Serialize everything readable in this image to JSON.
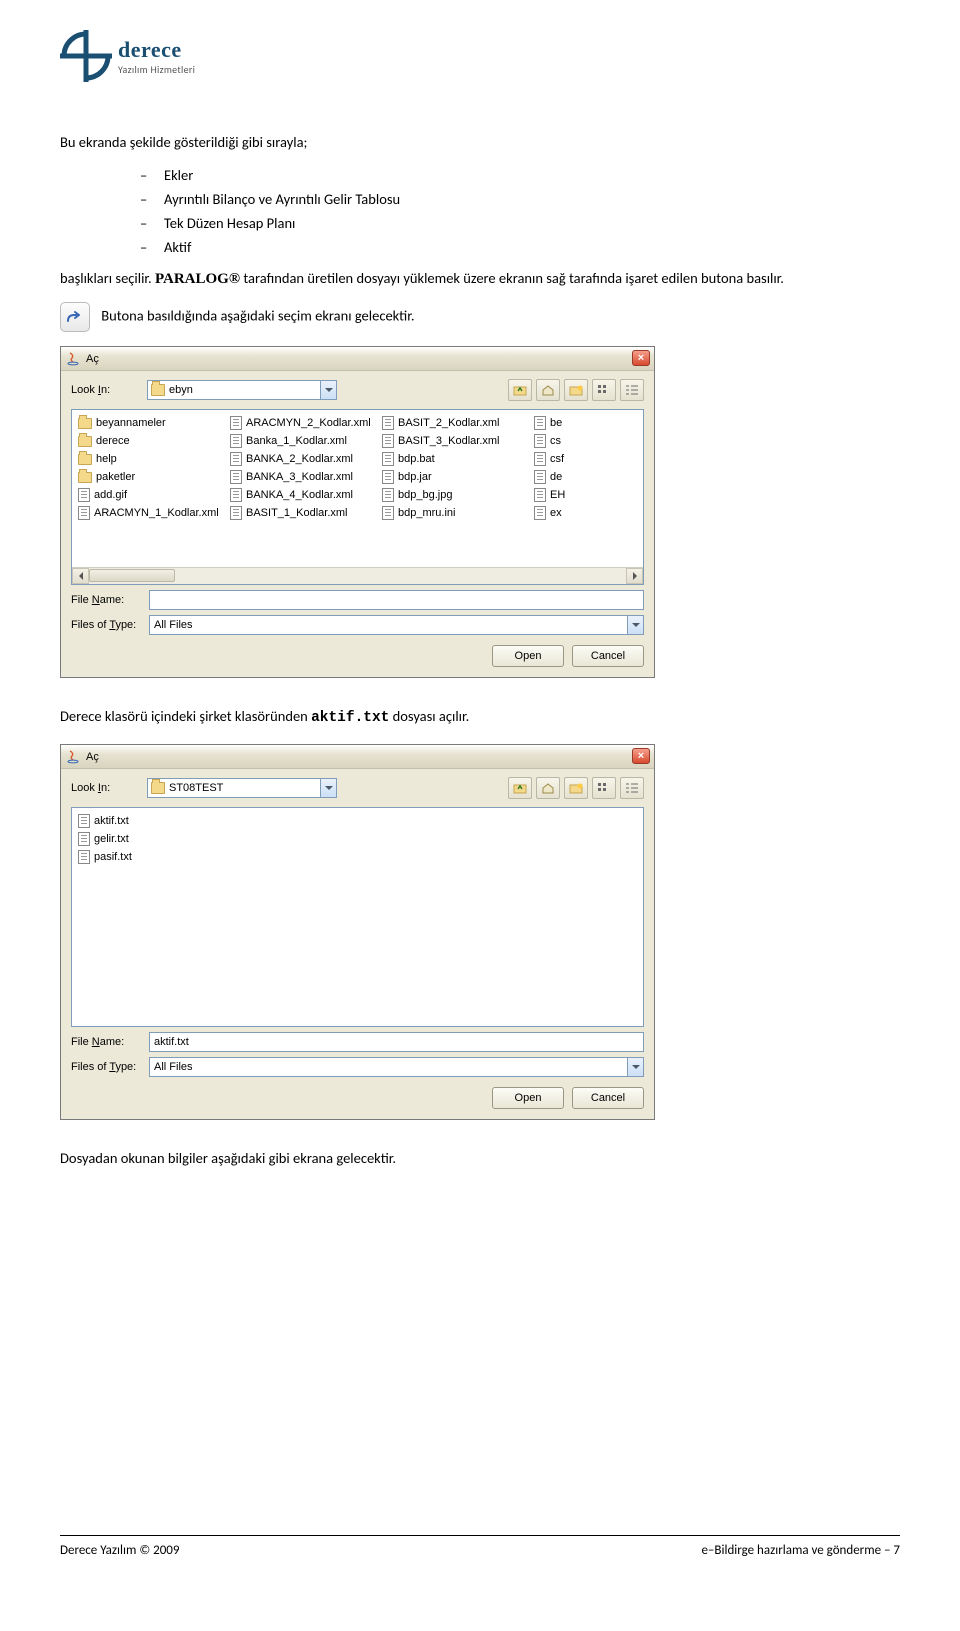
{
  "logo": {
    "brand": "derece",
    "tagline": "Yazılım Hizmetleri"
  },
  "intro": "Bu ekranda şekilde gösterildiği gibi sırayla;",
  "bullets": [
    "Ekler",
    "Ayrıntılı Bilanço ve Ayrıntılı Gelir Tablosu",
    "Tek Düzen Hesap Planı",
    "Aktif"
  ],
  "para1_pre": "başlıkları seçilir. ",
  "para1_brand": "PARALOG®",
  "para1_post": " tarafından üretilen dosyayı yüklemek üzere ekranın sağ tarafında işaret edilen butona basılır.",
  "para2": "Butona basıldığında aşağıdaki seçim ekranı gelecektir.",
  "para3_pre": "Derece klasörü içindeki şirket klasöründen ",
  "para3_code": "aktif.txt",
  "para3_post": " dosyası açılır.",
  "para4": "Dosyadan okunan bilgiler aşağıdaki gibi ekrana gelecektir.",
  "dialog1": {
    "title": "Aç",
    "lookin_label_pre": "Look ",
    "lookin_label_u": "I",
    "lookin_label_post": "n:",
    "lookin_value": "ebyn",
    "cols": [
      [
        {
          "t": "folder",
          "n": "beyannameler"
        },
        {
          "t": "folder",
          "n": "derece"
        },
        {
          "t": "folder",
          "n": "help"
        },
        {
          "t": "folder",
          "n": "paketler"
        },
        {
          "t": "file",
          "n": "add.gif"
        },
        {
          "t": "file",
          "n": "ARACMYN_1_Kodlar.xml"
        }
      ],
      [
        {
          "t": "file",
          "n": "ARACMYN_2_Kodlar.xml"
        },
        {
          "t": "file",
          "n": "Banka_1_Kodlar.xml"
        },
        {
          "t": "file",
          "n": "BANKA_2_Kodlar.xml"
        },
        {
          "t": "file",
          "n": "BANKA_3_Kodlar.xml"
        },
        {
          "t": "file",
          "n": "BANKA_4_Kodlar.xml"
        },
        {
          "t": "file",
          "n": "BASIT_1_Kodlar.xml"
        }
      ],
      [
        {
          "t": "file",
          "n": "BASIT_2_Kodlar.xml"
        },
        {
          "t": "file",
          "n": "BASIT_3_Kodlar.xml"
        },
        {
          "t": "file",
          "n": "bdp.bat"
        },
        {
          "t": "file",
          "n": "bdp.jar"
        },
        {
          "t": "file",
          "n": "bdp_bg.jpg"
        },
        {
          "t": "file",
          "n": "bdp_mru.ini"
        }
      ],
      [
        {
          "t": "file",
          "n": "be"
        },
        {
          "t": "file",
          "n": "cs"
        },
        {
          "t": "file",
          "n": "csf"
        },
        {
          "t": "file",
          "n": "de"
        },
        {
          "t": "file",
          "n": "EH"
        },
        {
          "t": "file",
          "n": "ex"
        }
      ]
    ],
    "filename_label_pre": "File ",
    "filename_label_u": "N",
    "filename_label_post": "ame:",
    "filename_value": "",
    "filetype_label_pre": "Files of ",
    "filetype_label_u": "T",
    "filetype_label_post": "ype:",
    "filetype_value": "All Files",
    "open": "Open",
    "cancel": "Cancel"
  },
  "dialog2": {
    "title": "Aç",
    "lookin_label_pre": "Look ",
    "lookin_label_u": "I",
    "lookin_label_post": "n:",
    "lookin_value": "ST08TEST",
    "cols": [
      [
        {
          "t": "file",
          "n": "aktif.txt"
        },
        {
          "t": "file",
          "n": "gelir.txt"
        },
        {
          "t": "file",
          "n": "pasif.txt"
        }
      ]
    ],
    "filename_value": "aktif.txt",
    "filetype_value": "All Files",
    "open": "Open",
    "cancel": "Cancel"
  },
  "footer": {
    "left": "Derece Yazılım © 2009",
    "right": "e–Bildirge hazırlama ve gönderme – 7"
  }
}
